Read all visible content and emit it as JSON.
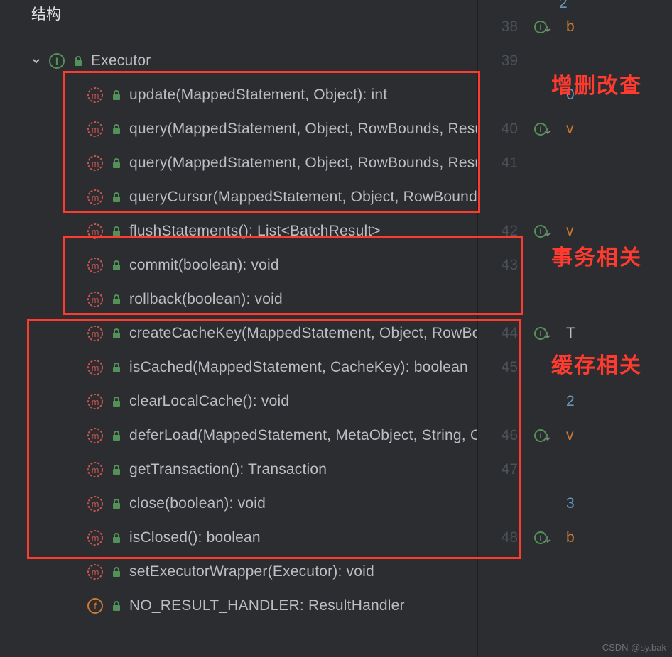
{
  "panel": {
    "title": "结构"
  },
  "root": {
    "label": "Executor"
  },
  "methods": [
    {
      "label": "update(MappedStatement, Object): int"
    },
    {
      "label": "query(MappedStatement, Object, RowBounds, ResultHandler)"
    },
    {
      "label": "query(MappedStatement, Object, RowBounds, ResultHandler, CacheKey)"
    },
    {
      "label": "queryCursor(MappedStatement, Object, RowBounds)"
    },
    {
      "label": "flushStatements(): List<BatchResult>"
    },
    {
      "label": "commit(boolean): void"
    },
    {
      "label": "rollback(boolean): void"
    },
    {
      "label": "createCacheKey(MappedStatement, Object, RowBounds, BoundSql)"
    },
    {
      "label": "isCached(MappedStatement, CacheKey): boolean"
    },
    {
      "label": "clearLocalCache(): void"
    },
    {
      "label": "deferLoad(MappedStatement, MetaObject, String, CacheKey, Class)"
    },
    {
      "label": "getTransaction(): Transaction"
    },
    {
      "label": "close(boolean): void"
    },
    {
      "label": "isClosed(): boolean"
    },
    {
      "label": "setExecutorWrapper(Executor): void"
    }
  ],
  "fields": [
    {
      "label": "NO_RESULT_HANDLER: ResultHandler"
    }
  ],
  "annotations": {
    "a1": "增删改查",
    "a2": "事务相关",
    "a3": "缓存相关"
  },
  "gutter": {
    "lines": [
      "38",
      "39",
      "",
      "40",
      "41",
      "",
      "42",
      "43",
      "",
      "44",
      "45",
      "",
      "46",
      "47",
      "",
      "48"
    ],
    "iconRows": [
      true,
      false,
      false,
      true,
      false,
      false,
      true,
      false,
      false,
      true,
      false,
      false,
      true,
      false,
      false,
      true
    ],
    "code": [
      "b",
      "",
      "0",
      "v",
      "",
      "",
      "v",
      "",
      "",
      "T",
      "",
      "2",
      "v",
      "",
      "3",
      "b"
    ],
    "preNum": "2"
  },
  "watermark": "CSDN @sy.bak"
}
